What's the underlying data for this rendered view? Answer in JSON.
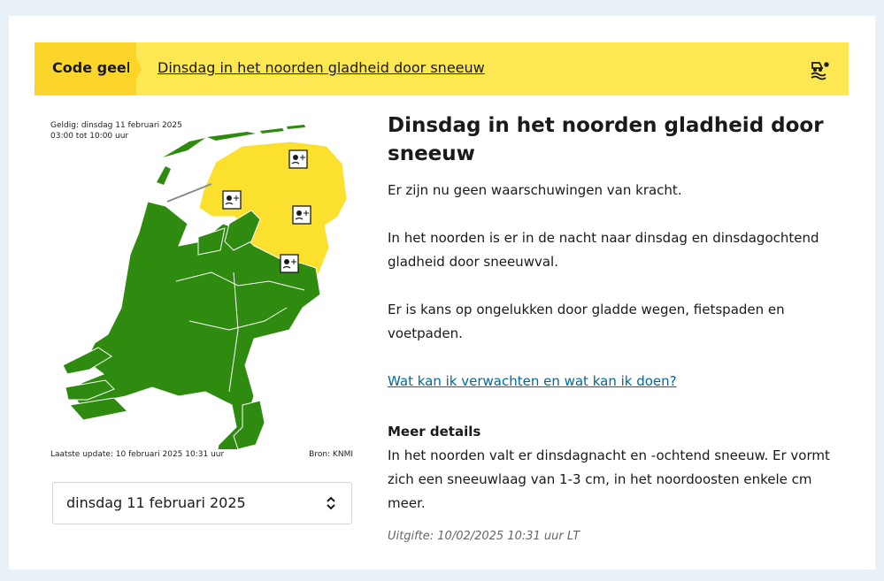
{
  "banner": {
    "code_label": "Code geel",
    "link_text": "Dinsdag in het noorden gladheid door sneeuw",
    "icon": "slippery-snow-icon",
    "color_bg": "#fde753",
    "color_tag": "#fbd52a"
  },
  "map": {
    "validity_line1": "Geldig: dinsdag 11 februari 2025",
    "validity_line2": "03:00 tot 10:00 uur",
    "update": "Laatste update: 10 februari 2025 10:31 uur",
    "source": "Bron: KNMI",
    "color_warning": "#fbe12e",
    "color_safe": "#2e8b0f"
  },
  "date_select": {
    "value": "dinsdag 11 februari 2025"
  },
  "content": {
    "title": "Dinsdag in het noorden gladheid door sneeuw",
    "para1": "Er zijn nu geen waarschuwingen van kracht.",
    "para2": "In het noorden is er in de nacht naar dinsdag en dinsdagochtend gladheid door sneeuwval.",
    "para3": "Er is kans op ongelukken door gladde wegen, fietspaden en voetpaden.",
    "faq_link": "Wat kan ik verwachten en wat kan ik doen?",
    "details_heading": "Meer details",
    "details_text": "In het noorden valt er dinsdagnacht en -ochtend sneeuw. Er vormt zich een sneeuwlaag van 1-3 cm, in het noordoosten enkele cm meer.",
    "issued": "Uitgifte: 10/02/2025 10:31 uur LT"
  }
}
